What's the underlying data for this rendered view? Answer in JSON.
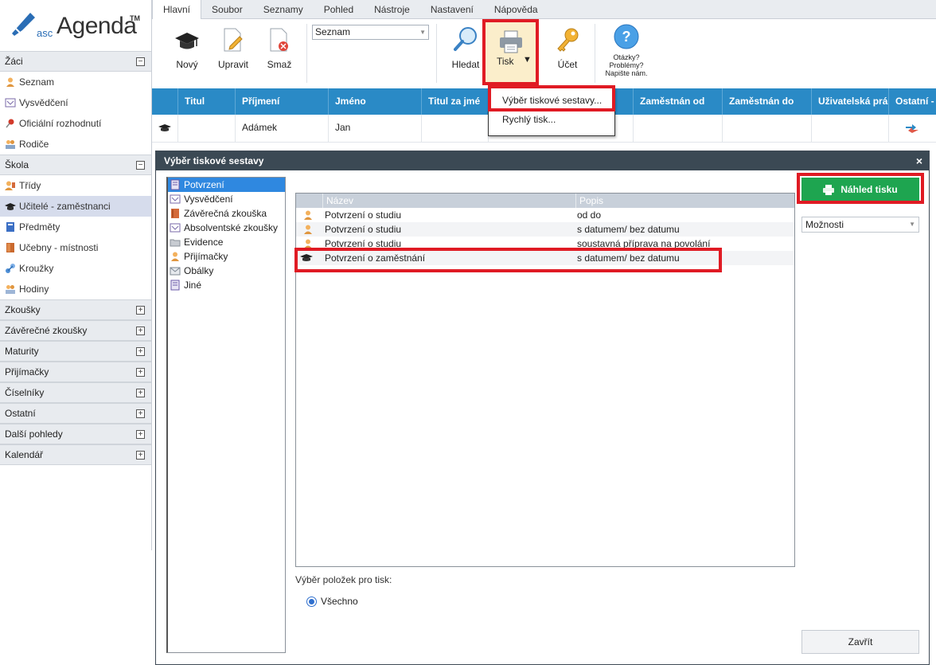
{
  "app": {
    "logo_asc": "asc",
    "logo_name": "Agenda",
    "logo_tm": "TM"
  },
  "menu": {
    "tabs": [
      "Hlavní",
      "Soubor",
      "Seznamy",
      "Pohled",
      "Nástroje",
      "Nastavení",
      "Nápověda"
    ],
    "active": "Hlavní"
  },
  "toolbar": {
    "new_label": "Nový",
    "edit_label": "Upravit",
    "delete_label": "Smaž",
    "view_select": "Seznam",
    "find_label": "Hledat",
    "print_label": "Tisk",
    "account_label": "Účet",
    "help_line1": "Otázky?",
    "help_line2": "Problémy?",
    "help_line3": "Napište nám."
  },
  "print_menu": {
    "items": [
      "Výběr tiskové sestavy...",
      "Rychlý tisk..."
    ]
  },
  "sidebar": {
    "sections": [
      {
        "title": "Žáci",
        "toggle": "−",
        "items": [
          "Seznam",
          "Vysvědčení",
          "Oficiální rozhodnutí",
          "Rodiče"
        ]
      },
      {
        "title": "Škola",
        "toggle": "−",
        "items": [
          "Třídy",
          "Učitelé - zaměstnanci",
          "Předměty",
          "Učebny - místnosti",
          "Kroužky",
          "Hodiny"
        ]
      },
      {
        "title": "Zkoušky",
        "toggle": "+"
      },
      {
        "title": "Závěrečné zkoušky",
        "toggle": "+"
      },
      {
        "title": "Maturity",
        "toggle": "+"
      },
      {
        "title": "Přijímačky",
        "toggle": "+"
      },
      {
        "title": "Číselníky",
        "toggle": "+"
      },
      {
        "title": "Ostatní",
        "toggle": "+"
      },
      {
        "title": "Další pohledy",
        "toggle": "+"
      },
      {
        "title": "Kalendář",
        "toggle": "+"
      }
    ],
    "selected_item": "Učitelé - zaměstnanci"
  },
  "grid": {
    "columns": [
      "Titul",
      "Příjmení",
      "Jméno",
      "Titul za jmé",
      "Zaměstnán od",
      "Zaměstnán do",
      "Uživatelská prá",
      "Ostatní -"
    ],
    "rows": [
      {
        "prijmeni": "Adámek",
        "jmeno": "Jan"
      }
    ]
  },
  "dialog": {
    "title": "Výběr tiskové sestavy",
    "close": "×",
    "categories": [
      "Potvrzení",
      "Vysvědčení",
      "Závěrečná zkouška",
      "Absolventské zkoušky",
      "Evidence",
      "Přijímačky",
      "Obálky",
      "Jiné"
    ],
    "selected_category": "Potvrzení",
    "table": {
      "col_name": "Název",
      "col_desc": "Popis",
      "rows": [
        {
          "name": "Potvrzení o studiu",
          "desc": "od do"
        },
        {
          "name": "Potvrzení o studiu",
          "desc": "s datumem/ bez datumu"
        },
        {
          "name": "Potvrzení o studiu",
          "desc": "soustavná příprava na povolání"
        },
        {
          "name": "Potvrzení o zaměstnání",
          "desc": "s datumem/ bez datumu"
        }
      ]
    },
    "print_items_label": "Výběr položek pro tisk:",
    "radio_all": "Všechno",
    "preview_button": "Náhled tisku",
    "options_select": "Možnosti",
    "close_button": "Zavřít"
  },
  "colors": {
    "grid_header": "#2a8ac6",
    "highlight_red": "#e01b24",
    "preview_green": "#1ea550",
    "dialog_title": "#3b4954",
    "selected_blue": "#2f88e0"
  }
}
